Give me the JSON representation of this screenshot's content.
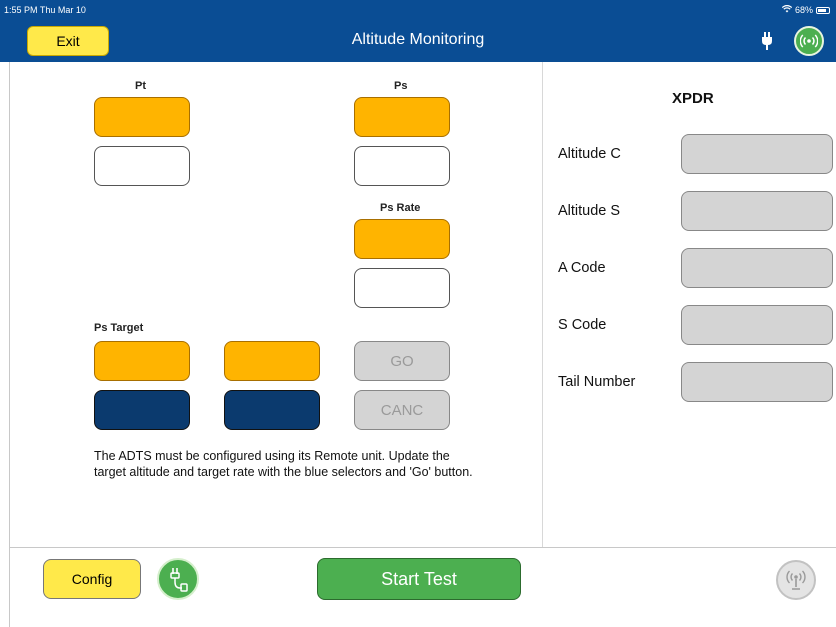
{
  "status_bar": {
    "time": "1:55 PM  Thu Mar 10",
    "battery": "68%"
  },
  "header": {
    "exit_label": "Exit",
    "title": "Altitude Monitoring"
  },
  "left_panel": {
    "pt_label": "Pt",
    "ps_label": "Ps",
    "ps_rate_label": "Ps Rate",
    "ps_target_label": "Ps Target",
    "go_label": "GO",
    "canc_label": "CANC",
    "info_text": "The ADTS must be configured using its Remote unit. Update the target altitude and target rate with the blue selectors and 'Go' button."
  },
  "xpdr": {
    "title": "XPDR",
    "fields": [
      {
        "label": "Altitude C",
        "value": ""
      },
      {
        "label": "Altitude S",
        "value": ""
      },
      {
        "label": "A Code",
        "value": ""
      },
      {
        "label": "S Code",
        "value": ""
      },
      {
        "label": "Tail Number",
        "value": ""
      }
    ]
  },
  "footer": {
    "config_label": "Config",
    "start_label": "Start Test"
  },
  "colors": {
    "header_bg": "#0a4d94",
    "value_orange": "#ffb400",
    "selector_navy": "#0b3a6e",
    "accent_green": "#4caf50",
    "button_yellow": "#ffe94a"
  }
}
